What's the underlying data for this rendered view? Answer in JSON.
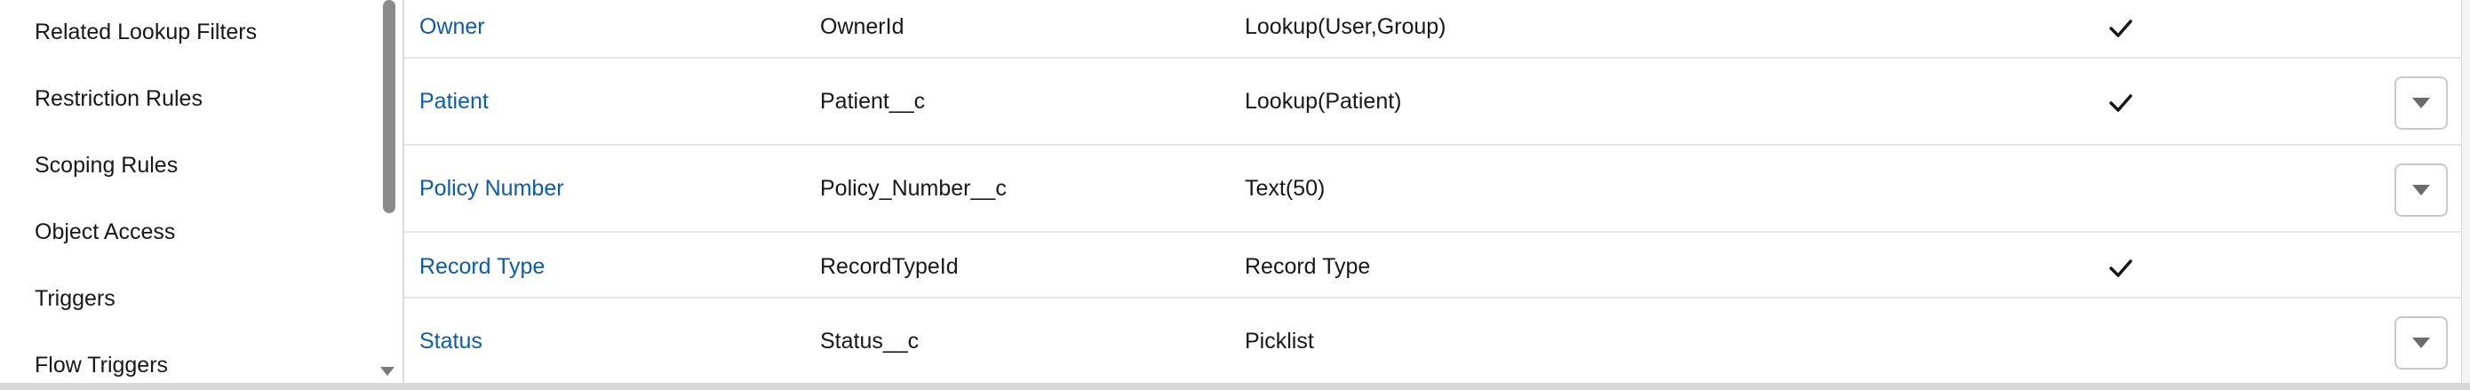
{
  "sidebar": {
    "items": [
      {
        "label": "Related Lookup Filters"
      },
      {
        "label": "Restriction Rules"
      },
      {
        "label": "Scoping Rules"
      },
      {
        "label": "Object Access"
      },
      {
        "label": "Triggers"
      },
      {
        "label": "Flow Triggers"
      }
    ]
  },
  "fields": {
    "rows": [
      {
        "label": "Owner",
        "api_name": "OwnerId",
        "data_type": "Lookup(User,Group)",
        "indexed": true,
        "has_menu": false
      },
      {
        "label": "Patient",
        "api_name": "Patient__c",
        "data_type": "Lookup(Patient)",
        "indexed": true,
        "has_menu": true
      },
      {
        "label": "Policy Number",
        "api_name": "Policy_Number__c",
        "data_type": "Text(50)",
        "indexed": false,
        "has_menu": true
      },
      {
        "label": "Record Type",
        "api_name": "RecordTypeId",
        "data_type": "Record Type",
        "indexed": true,
        "has_menu": false
      },
      {
        "label": "Status",
        "api_name": "Status__c",
        "data_type": "Picklist",
        "indexed": false,
        "has_menu": true
      }
    ]
  },
  "icons": {
    "check": "checkmark-icon",
    "menu": "chevron-down-icon",
    "scroll_down": "scroll-down-arrow-icon"
  },
  "colors": {
    "link": "#0b5cab",
    "text": "#181818",
    "divider": "#e5e5e5"
  }
}
